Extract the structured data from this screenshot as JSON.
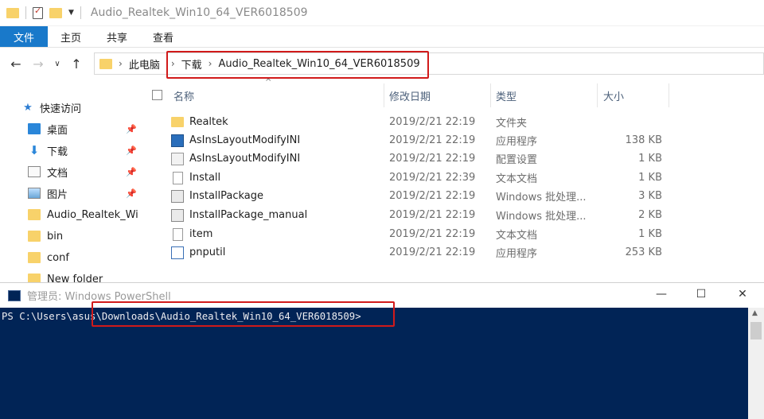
{
  "window": {
    "title": "Audio_Realtek_Win10_64_VER6018509"
  },
  "ribbon": {
    "tabs": [
      "文件",
      "主页",
      "共享",
      "查看"
    ]
  },
  "address": {
    "crumbs": [
      "此电脑",
      "下载",
      "Audio_Realtek_Win10_64_VER6018509"
    ]
  },
  "nav": {
    "quick_access": "快速访问",
    "items": [
      {
        "label": "桌面",
        "icon": "desktop-icon",
        "pinned": true
      },
      {
        "label": "下载",
        "icon": "download-icon",
        "pinned": true
      },
      {
        "label": "文档",
        "icon": "document-icon",
        "pinned": true
      },
      {
        "label": "图片",
        "icon": "picture-icon",
        "pinned": true
      },
      {
        "label": "Audio_Realtek_Wi",
        "icon": "folder-icon",
        "pinned": false
      },
      {
        "label": "bin",
        "icon": "folder-icon",
        "pinned": false
      },
      {
        "label": "conf",
        "icon": "folder-icon",
        "pinned": false
      },
      {
        "label": "New folder",
        "icon": "folder-icon",
        "pinned": false
      }
    ]
  },
  "columns": {
    "name": "名称",
    "date": "修改日期",
    "type": "类型",
    "size": "大小"
  },
  "files": [
    {
      "name": "Realtek",
      "date": "2019/2/21 22:19",
      "type": "文件夹",
      "size": "",
      "icon": "folder-icon"
    },
    {
      "name": "AsInsLayoutModifyINI",
      "date": "2019/2/21 22:19",
      "type": "应用程序",
      "size": "138 KB",
      "icon": "exe-icon"
    },
    {
      "name": "AsInsLayoutModifyINI",
      "date": "2019/2/21 22:19",
      "type": "配置设置",
      "size": "1 KB",
      "icon": "ini-icon"
    },
    {
      "name": "Install",
      "date": "2019/2/21 22:39",
      "type": "文本文档",
      "size": "1 KB",
      "icon": "text-file-icon"
    },
    {
      "name": "InstallPackage",
      "date": "2019/2/21 22:19",
      "type": "Windows 批处理...",
      "size": "3 KB",
      "icon": "batch-file-icon"
    },
    {
      "name": "InstallPackage_manual",
      "date": "2019/2/21 22:19",
      "type": "Windows 批处理...",
      "size": "2 KB",
      "icon": "batch-file-icon"
    },
    {
      "name": "item",
      "date": "2019/2/21 22:19",
      "type": "文本文档",
      "size": "1 KB",
      "icon": "text-file-icon"
    },
    {
      "name": "pnputil",
      "date": "2019/2/21 22:19",
      "type": "应用程序",
      "size": "253 KB",
      "icon": "exe-icon"
    }
  ],
  "powershell": {
    "title": "管理员: Windows PowerShell",
    "prompt": "PS C:\\Users\\asus\\Downloads\\Audio_Realtek_Win10_64_VER6018509>",
    "buttons": [
      "—",
      "☐",
      "✕"
    ]
  },
  "colors": {
    "accent": "#1979ca",
    "highlight": "#d11a1a",
    "ps_bg": "#012456"
  }
}
